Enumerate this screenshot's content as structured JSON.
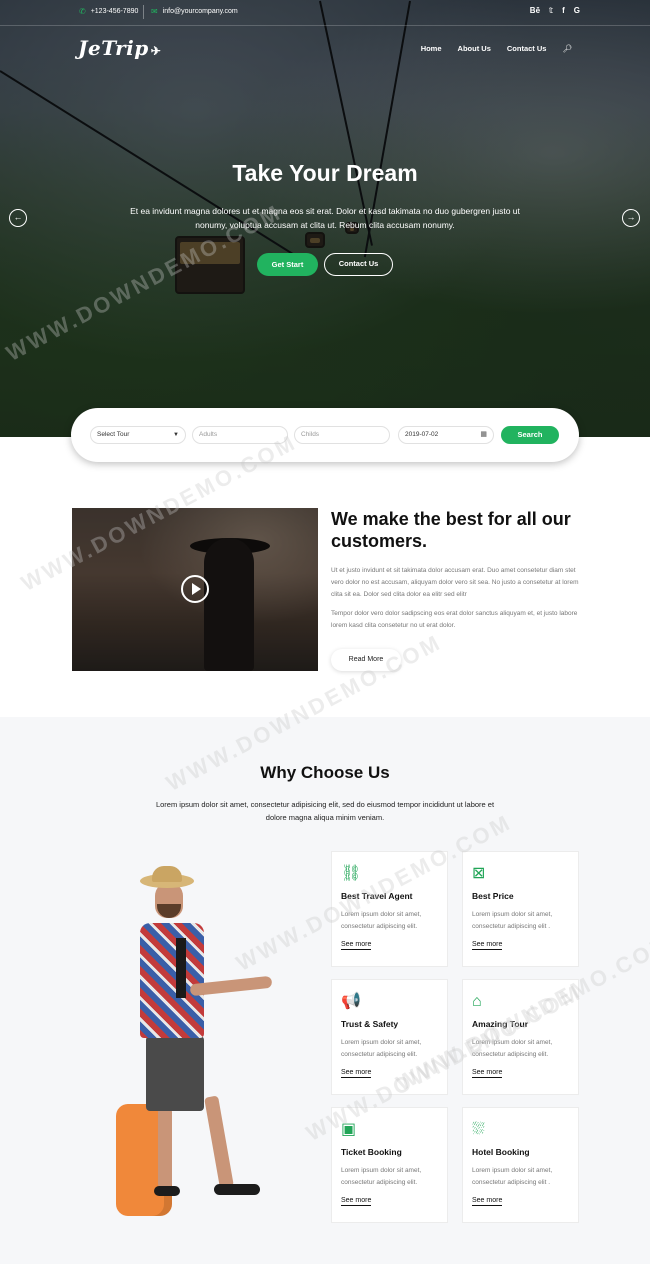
{
  "topbar": {
    "phone": "+123-456-7890",
    "email": "info@yourcompany.com",
    "social": [
      "Bē",
      "𝕥",
      "f",
      "G"
    ]
  },
  "brand": {
    "logo": "JeTrip"
  },
  "nav": {
    "items": [
      "Home",
      "About Us",
      "Contact Us"
    ]
  },
  "hero": {
    "title": "Take Your Dream",
    "text": "Et ea invidunt magna dolores ut et magna eos sit erat. Dolor et kasd takimata no duo gubergren justo ut nonumy, voluptua accusam at clita ut. Rebum clita accusam nonumy.",
    "primary_button": "Get Start",
    "secondary_button": "Contact Us"
  },
  "search": {
    "tour_select": "Select Tour",
    "adults_placeholder": "Adults",
    "childs_placeholder": "Childs",
    "date_value": "2019-07-02",
    "button": "Search"
  },
  "about": {
    "title": "We make the best for all our customers.",
    "p1": "Ut et justo invidunt et sit takimata dolor accusam erat. Duo amet consetetur diam stet vero dolor no est accusam, aliquyam dolor vero sit sea. No justo a consetetur at lorem clita sit ea. Dolor sed clita dolor ea elitr sed elitr",
    "p2": "Tempor dolor vero dolor sadipscing eos erat dolor sanctus aliquyam et, et justo labore lorem kasd clita consetetur no ut erat dolor.",
    "read_more": "Read More"
  },
  "why": {
    "title": "Why Choose Us",
    "subtitle": "Lorem ipsum dolor sit amet, consectetur adipisicing elit, sed do eiusmod tempor incididunt ut labore et dolore magna aliqua minim veniam.",
    "cards": [
      {
        "title": "Best Travel Agent",
        "text": "Lorem ipsum dolor sit amet, consectetur adipiscing elit.",
        "more": "See more",
        "icon": "route-icon",
        "glyph": "⛓"
      },
      {
        "title": "Best Price",
        "text": "Lorem ipsum dolor sit amet, consectetur adipiscing elit .",
        "more": "See more",
        "icon": "tag-icon",
        "glyph": "⊠"
      },
      {
        "title": "Trust & Safety",
        "text": "Lorem ipsum dolor sit amet, consectetur adipiscing elit.",
        "more": "See more",
        "icon": "megaphone-icon",
        "glyph": "📢"
      },
      {
        "title": "Amazing Tour",
        "text": "Lorem ipsum dolor sit amet, consectetur adipiscing elit.",
        "more": "See more",
        "icon": "home-icon",
        "glyph": "⌂"
      },
      {
        "title": "Ticket Booking",
        "text": "Lorem ipsum dolor sit amet, consectetur adipiscing elit.",
        "more": "See more",
        "icon": "ticket-icon",
        "glyph": "▣"
      },
      {
        "title": "Hotel Booking",
        "text": "Lorem ipsum dolor sit amet, consectetur adipiscing elit .",
        "more": "See more",
        "icon": "bed-icon",
        "glyph": "⛆"
      }
    ]
  },
  "watermark": "WWW.DOWNDEMO.COM",
  "colors": {
    "accent": "#21b35f",
    "dark": "#111111",
    "muted": "#777777",
    "section_bg": "#f6f7f9"
  }
}
